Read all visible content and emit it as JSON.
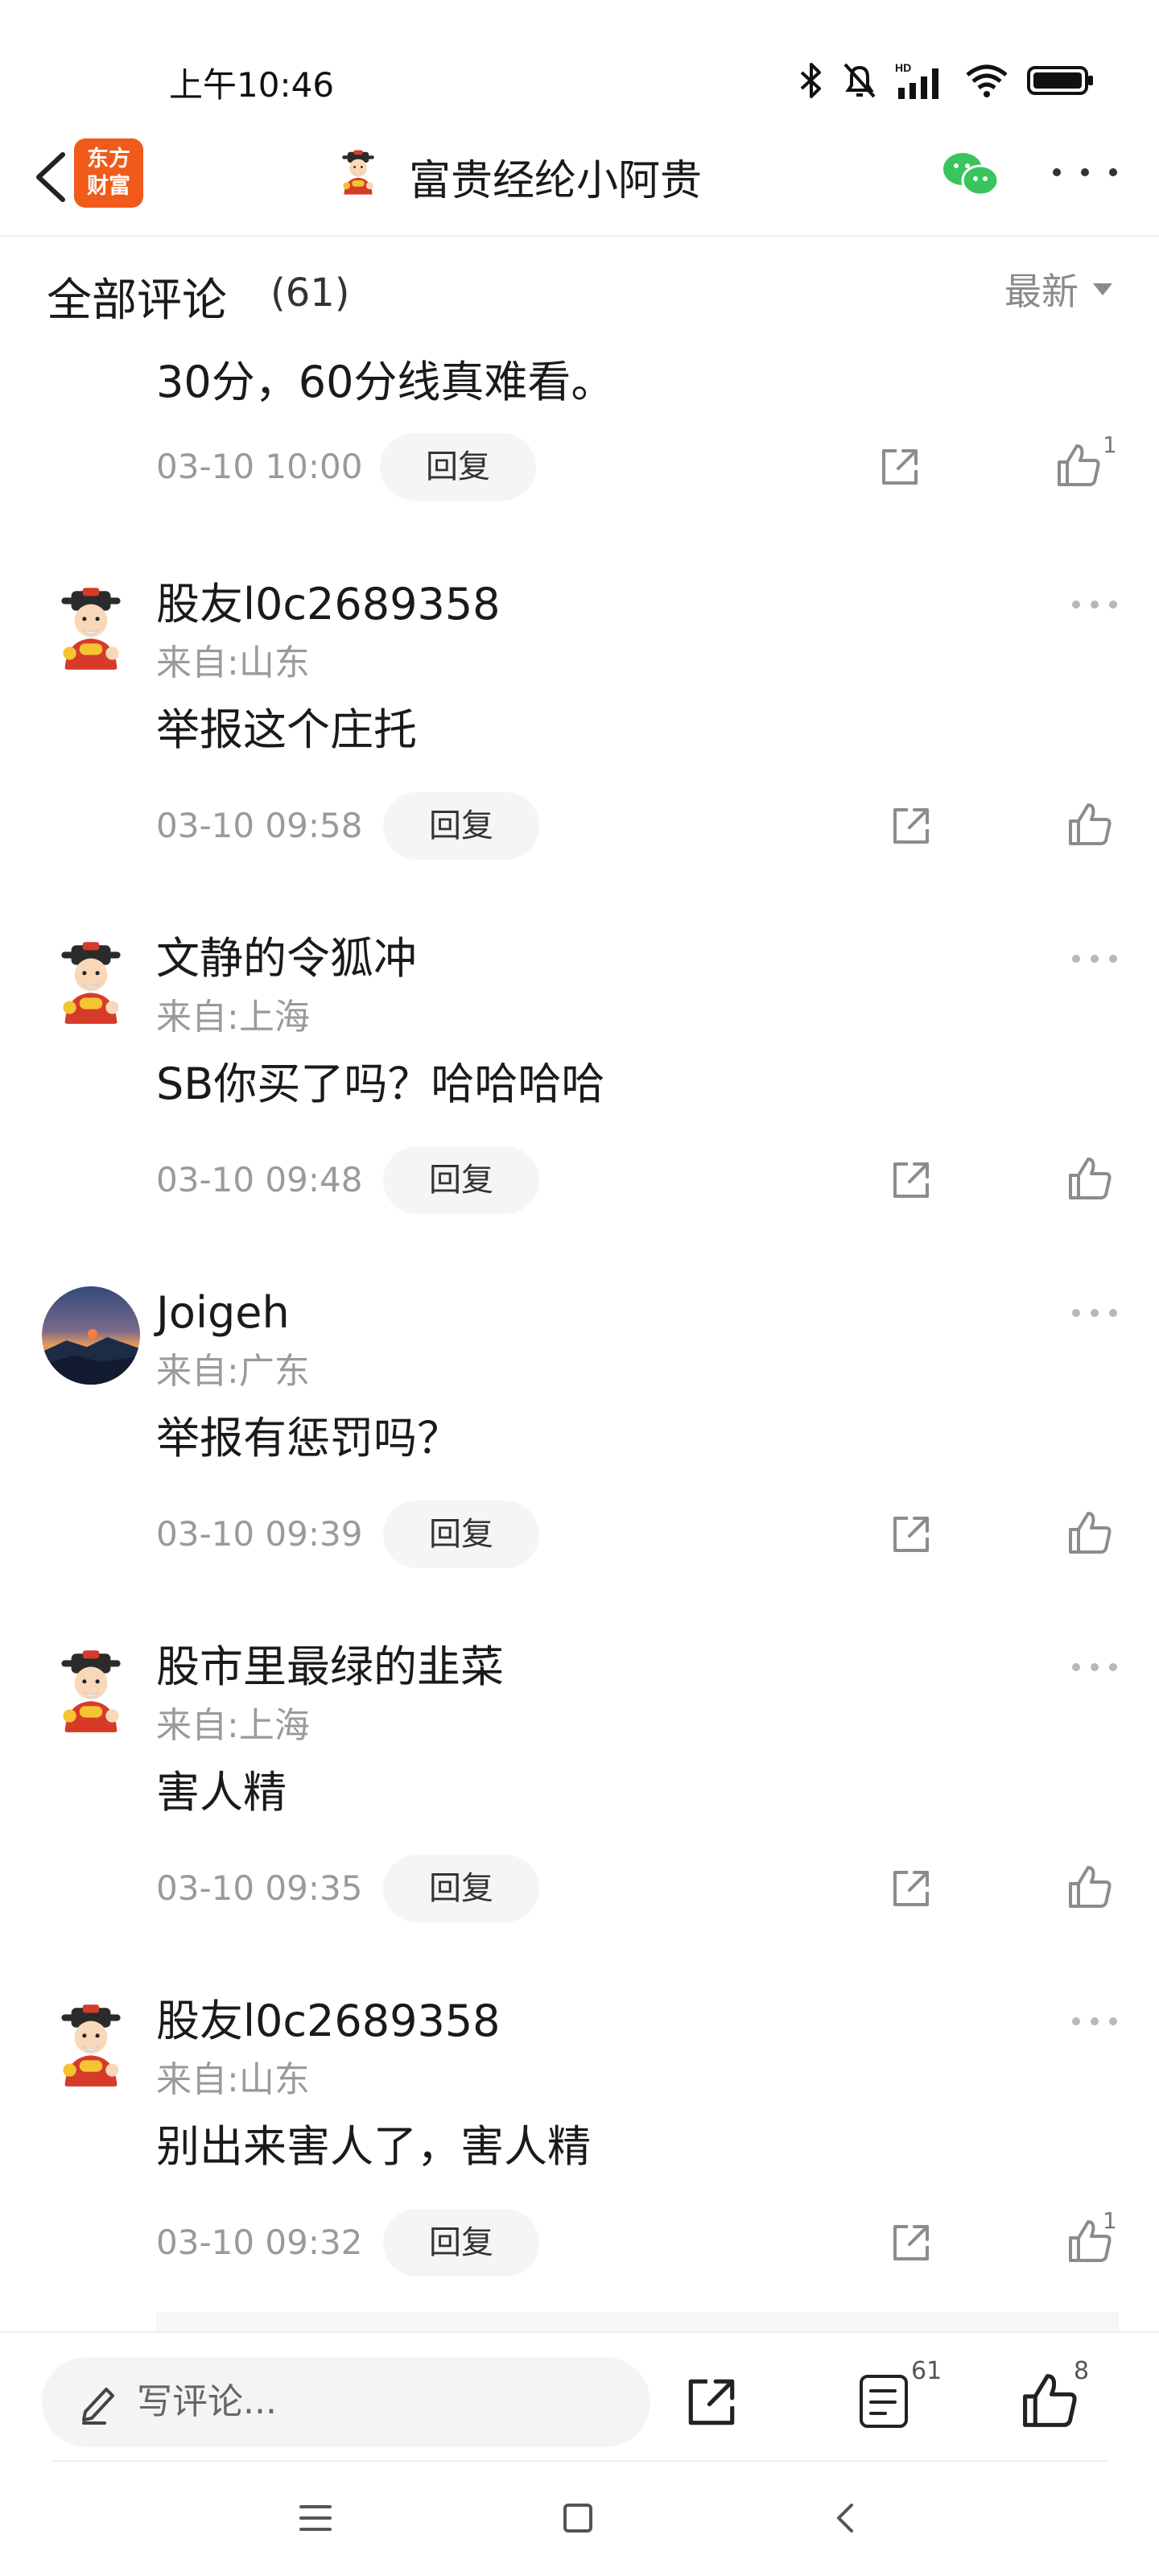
{
  "status_bar": {
    "time": "上午10:46",
    "network_badge": "HD",
    "icons": [
      "bluetooth-icon",
      "mute-bell-icon",
      "signal-icon",
      "wifi-icon",
      "battery-icon"
    ]
  },
  "title_bar": {
    "logo_line1": "东方",
    "logo_line2": "财富",
    "title": "富贵经纶小阿贵",
    "accent_color": "#f05a1a",
    "wechat_color": "#39c45d"
  },
  "comments_header": {
    "title": "全部评论",
    "count": "(61)",
    "sort_label": "最新"
  },
  "first_comment": {
    "content": "30分，60分线真难看。",
    "date": "03-10 10:00",
    "reply_label": "回复",
    "likes": "1"
  },
  "comments": [
    {
      "username": "股友l0c2689358",
      "location": "来自:山东",
      "content": "举报这个庄托",
      "date": "03-10 09:58",
      "reply_label": "回复",
      "likes": "",
      "avatar": "fortune-god"
    },
    {
      "username": "文静的令狐冲",
      "location": "来自:上海",
      "content": "SB你买了吗？哈哈哈哈",
      "date": "03-10 09:48",
      "reply_label": "回复",
      "likes": "",
      "avatar": "fortune-god"
    },
    {
      "username": "Joigeh",
      "location": "来自:广东",
      "content": "举报有惩罚吗？",
      "date": "03-10 09:39",
      "reply_label": "回复",
      "likes": "",
      "avatar": "sunset-photo"
    },
    {
      "username": "股市里最绿的韭菜",
      "location": "来自:上海",
      "content": "害人精",
      "date": "03-10 09:35",
      "reply_label": "回复",
      "likes": "",
      "avatar": "fortune-god"
    },
    {
      "username": "股友l0c2689358",
      "location": "来自:山东",
      "content": "别出来害人了，害人精",
      "date": "03-10 09:32",
      "reply_label": "回复",
      "likes": "1",
      "avatar": "fortune-god"
    }
  ],
  "bottom_bar": {
    "input_placeholder": "写评论...",
    "comment_count": "61",
    "like_count": "8"
  }
}
